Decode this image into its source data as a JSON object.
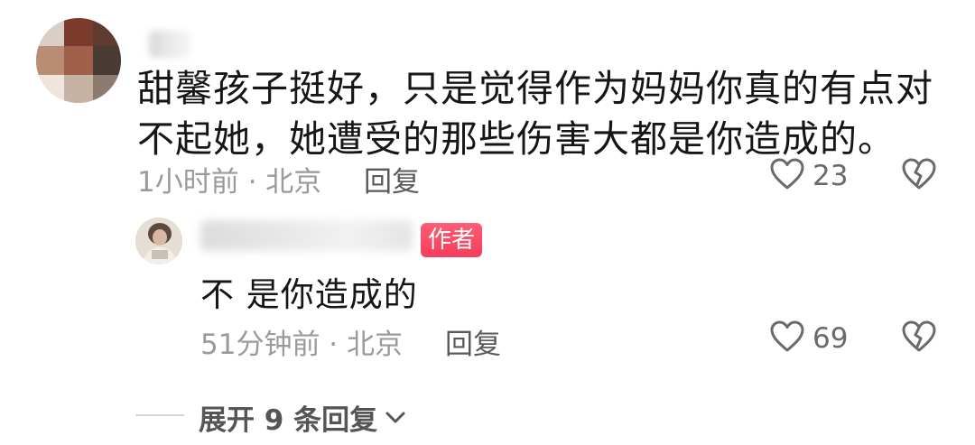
{
  "comment": {
    "text": "甜馨孩子挺好，只是觉得作为妈妈你真的有点对不起她，她遭受的那些伤害大都是你造成的。",
    "time_location": "1小时前 · 北京",
    "reply_label": "回复",
    "like_count": "23",
    "icons": {
      "like": "heart-outline-icon",
      "dislike": "broken-heart-icon"
    }
  },
  "reply": {
    "author_badge": "作者",
    "text": "不 是你造成的",
    "time_location": "51分钟前 · 北京",
    "reply_label": "回复",
    "like_count": "69",
    "icons": {
      "like": "heart-outline-icon",
      "dislike": "broken-heart-icon"
    }
  },
  "expand": {
    "label": "展开 9 条回复",
    "icon": "chevron-down-icon"
  },
  "colors": {
    "badge": "#f43d5c",
    "meta": "#9a9a9a",
    "text": "#161616"
  }
}
